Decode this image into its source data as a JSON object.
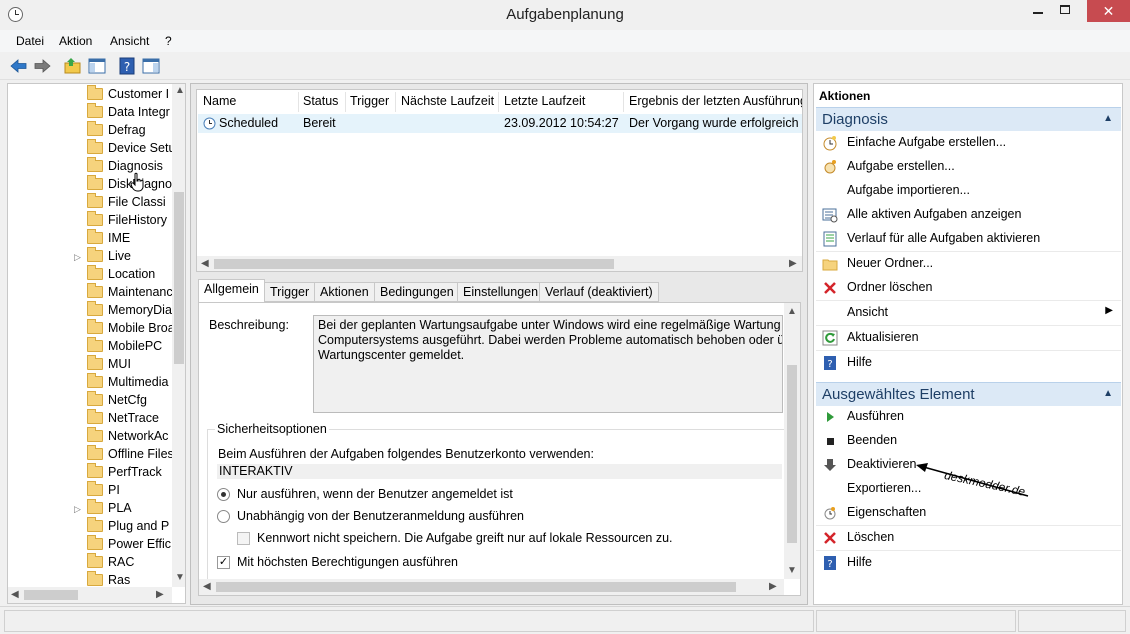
{
  "window": {
    "title": "Aufgabenplanung",
    "close_glyph": "✕"
  },
  "menubar": {
    "items": [
      "Datei",
      "Aktion",
      "Ansicht",
      "?"
    ]
  },
  "toolbar": {
    "icons": [
      "back-arrow-icon",
      "forward-arrow-icon",
      "folder-up-icon",
      "show-hide-console-tree-icon",
      "help-icon",
      "show-hide-action-pane-icon"
    ]
  },
  "tree": {
    "selected": "Diagnosis",
    "items": [
      {
        "label": "Customer I",
        "expandable": false
      },
      {
        "label": "Data Integr",
        "expandable": false
      },
      {
        "label": "Defrag",
        "expandable": false
      },
      {
        "label": "Device Setu",
        "expandable": false
      },
      {
        "label": "Diagnosis",
        "expandable": false
      },
      {
        "label": "DiskDiagno",
        "expandable": false
      },
      {
        "label": "File Classi",
        "expandable": false
      },
      {
        "label": "FileHistory",
        "expandable": false
      },
      {
        "label": "IME",
        "expandable": false
      },
      {
        "label": "Live",
        "expandable": true
      },
      {
        "label": "Location",
        "expandable": false
      },
      {
        "label": "Maintenanc",
        "expandable": false
      },
      {
        "label": "MemoryDia",
        "expandable": false
      },
      {
        "label": "Mobile Broa",
        "expandable": false
      },
      {
        "label": "MobilePC",
        "expandable": false
      },
      {
        "label": "MUI",
        "expandable": false
      },
      {
        "label": "Multimedia",
        "expandable": false
      },
      {
        "label": "NetCfg",
        "expandable": false
      },
      {
        "label": "NetTrace",
        "expandable": false
      },
      {
        "label": "NetworkAc",
        "expandable": false
      },
      {
        "label": "Offline Files",
        "expandable": false
      },
      {
        "label": "PerfTrack",
        "expandable": false
      },
      {
        "label": "PI",
        "expandable": false
      },
      {
        "label": "PLA",
        "expandable": true
      },
      {
        "label": "Plug and P",
        "expandable": false
      },
      {
        "label": "Power Effic",
        "expandable": false
      },
      {
        "label": "RAC",
        "expandable": false
      },
      {
        "label": "Ras",
        "expandable": false
      }
    ]
  },
  "tasklist": {
    "columns": [
      "Name",
      "Status",
      "Trigger",
      "Nächste Laufzeit",
      "Letzte Laufzeit",
      "Ergebnis der letzten Ausführung"
    ],
    "rows": [
      {
        "name": "Scheduled",
        "status": "Bereit",
        "trigger": "",
        "next_run": "",
        "last_run": "23.09.2012 10:54:27",
        "result": "Der Vorgang wurde erfolgreich b"
      }
    ]
  },
  "details": {
    "tabs": [
      "Allgemein",
      "Trigger",
      "Aktionen",
      "Bedingungen",
      "Einstellungen",
      "Verlauf (deaktiviert)"
    ],
    "active_tab": "Allgemein",
    "description_label": "Beschreibung:",
    "description_lines": [
      "Bei der geplanten Wartungsaufgabe unter Windows wird eine regelmäßige Wartung des",
      "Computersystems ausgeführt. Dabei werden Probleme automatisch behoben oder über",
      "Wartungscenter gemeldet."
    ],
    "security_title": "Sicherheitsoptionen",
    "account_prompt": "Beim Ausführen der Aufgaben folgendes Benutzerkonto verwenden:",
    "account_value": "INTERAKTIV",
    "radio_logged_on": "Nur ausführen, wenn der Benutzer angemeldet ist",
    "radio_independent": "Unabhängig von der Benutzeranmeldung ausführen",
    "check_no_password": "Kennwort nicht speichern. Die Aufgabe greift nur auf lokale Ressourcen zu.",
    "check_highest": "Mit höchsten Berechtigungen ausführen",
    "radio_selected": "logged_on",
    "highest_checked": true
  },
  "actions": {
    "pane_title": "Aktionen",
    "sections": [
      {
        "title": "Diagnosis",
        "items": [
          {
            "label": "Einfache Aufgabe erstellen...",
            "icon": "create-basic-task-icon"
          },
          {
            "label": "Aufgabe erstellen...",
            "icon": "create-task-icon"
          },
          {
            "label": "Aufgabe importieren...",
            "icon": ""
          },
          {
            "label": "Alle aktiven Aufgaben anzeigen",
            "icon": "running-tasks-icon"
          },
          {
            "label": "Verlauf für alle Aufgaben aktivieren",
            "icon": "history-icon"
          },
          {
            "label": "Neuer Ordner...",
            "icon": "new-folder-icon"
          },
          {
            "label": "Ordner löschen",
            "icon": "delete-icon"
          },
          {
            "label": "Ansicht",
            "icon": "",
            "submenu": true
          },
          {
            "label": "Aktualisieren",
            "icon": "refresh-icon"
          },
          {
            "label": "Hilfe",
            "icon": "help-icon"
          }
        ]
      },
      {
        "title": "Ausgewähltes Element",
        "items": [
          {
            "label": "Ausführen",
            "icon": "run-icon"
          },
          {
            "label": "Beenden",
            "icon": "stop-icon"
          },
          {
            "label": "Deaktivieren",
            "icon": "disable-icon"
          },
          {
            "label": "Exportieren...",
            "icon": ""
          },
          {
            "label": "Eigenschaften",
            "icon": "properties-icon"
          },
          {
            "label": "Löschen",
            "icon": "delete-icon"
          },
          {
            "label": "Hilfe",
            "icon": "help-icon"
          }
        ]
      }
    ]
  },
  "annotation": {
    "text": "deskmodder.de"
  }
}
